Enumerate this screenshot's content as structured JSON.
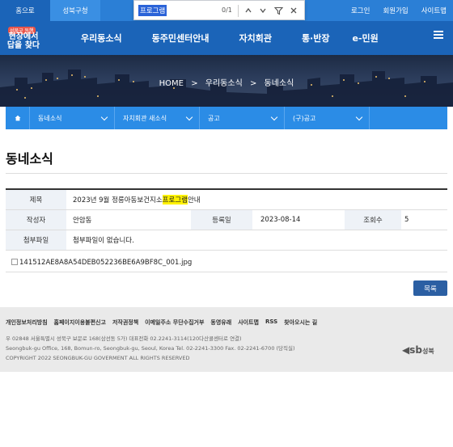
{
  "topbar": {
    "tabs": [
      "홈으로",
      "성북구청"
    ],
    "util": [
      "로그인",
      "회원가입",
      "사이트맵"
    ]
  },
  "findbar": {
    "query": "프로그램",
    "count": "0/1"
  },
  "logo": {
    "tag": "성북구 동행",
    "text": "현장에서 답을 찾다"
  },
  "gnb": {
    "items": [
      "우리동소식",
      "동주민센터안내",
      "자치회관",
      "통·반장",
      "e-민원"
    ]
  },
  "hero": {
    "home": "HOME",
    "sep": ">",
    "crumb1": "우리동소식",
    "crumb2": "동네소식"
  },
  "subnav": {
    "items": [
      "동네소식",
      "자치회관 새소식",
      "공고",
      "(구)공고"
    ]
  },
  "page": {
    "title": "동네소식"
  },
  "post": {
    "subject_label": "제목",
    "subject_before": "2023년 9월 정릉아동보건지소 ",
    "subject_highlight": "프로그램",
    "subject_after": " 안내",
    "author_label": "작성자",
    "author": "안암동",
    "date_label": "등록일",
    "date": "2023-08-14",
    "views_label": "조회수",
    "views": "5",
    "attach_label": "첨부파일",
    "attach": "첨부파일이 없습니다.",
    "image_alt": "141512AE8A8A54DEB052236BE6A9BF8C_001.jpg"
  },
  "buttons": {
    "list": "목록"
  },
  "footer": {
    "links": [
      "개인정보처리방침",
      "홈페이지이용불편신고",
      "저작권정책",
      "이메일주소 무단수집거부",
      "동영유래",
      "사이트맵",
      "RSS",
      "찾아오시는 길"
    ],
    "addr_ko": "우 02848 서울특별시 성북구 보문로 168(삼선동 5가) 대표전화 02.2241-3114(120다산콜센터로 연결)",
    "addr_en": "Seongbuk-gu Office, 168, Bomun-ro, Seongbuk-gu, Seoul, Korea Tel. 02-2241-3300 Fax. 02-2241-6700 (당직실)",
    "copyright": "COPYRIGHT 2022 SEONGBUK-GU GOVERMENT ALL RIGHTS RESERVED",
    "brand": "sb",
    "brand_sub": "성북"
  }
}
